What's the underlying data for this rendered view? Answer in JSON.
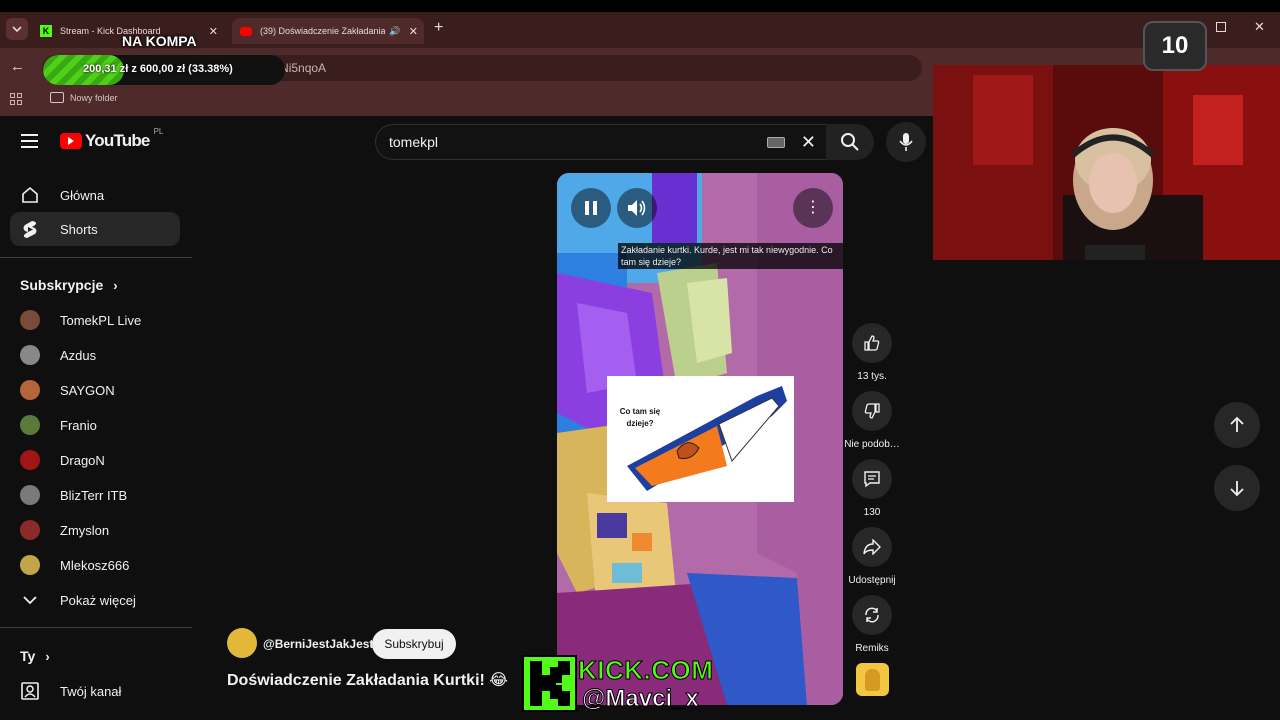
{
  "browser": {
    "tabs": [
      {
        "title": "Stream - Kick Dashboard"
      },
      {
        "title": "(39) Doświadczenie Zakładania K"
      }
    ],
    "new_tab": "+",
    "url_fragment": "n7dNi5nqoA",
    "bookmark_folder": "Nowy folder"
  },
  "overlay": {
    "na_kompa": "NA KOMPA",
    "goal_progress": "200,31 zł z 600,00 zł (33.38%)",
    "goal_fraction": 0.3338,
    "viewer_count": "10"
  },
  "youtube": {
    "logo_text": "YouTube",
    "region": "PL",
    "search_value": "tomekpl",
    "nav": {
      "home": "Główna",
      "shorts": "Shorts"
    },
    "subscriptions_title": "Subskrypcje",
    "subscriptions": [
      {
        "name": "TomekPL Live",
        "color": "#7a4a3a"
      },
      {
        "name": "Azdus",
        "color": "#888888"
      },
      {
        "name": "SAYGON",
        "color": "#b5653a"
      },
      {
        "name": "Franio",
        "color": "#5a7a3a"
      },
      {
        "name": "DragoN",
        "color": "#a01515"
      },
      {
        "name": "BlizTerr ITB",
        "color": "#7a7a7a"
      },
      {
        "name": "Zmyslon",
        "color": "#8a2a2a"
      },
      {
        "name": "Mlekosz666",
        "color": "#c2a54a"
      }
    ],
    "show_more": "Pokaż więcej",
    "you_title": "Ty",
    "your_channel": "Twój kanał"
  },
  "short": {
    "caption": "Zakładanie kurtki. Kurde, jest mi tak niewygodnie. Co tam się dzieje?",
    "drawing_text": "Co tam się dzieje?",
    "channel": "@BerniJestJakJest",
    "subscribe_label": "Subskrybuj",
    "title": "Doświadczenie Zakładania Kurtki! 😂",
    "likes": "13 tys.",
    "dislike": "Nie podob…",
    "comments": "130",
    "share": "Udostępnij",
    "remix": "Remiks"
  },
  "kick": {
    "site": "KICK.COM",
    "handle": "@Mavci_x",
    "brand_color": "#53fc18"
  }
}
